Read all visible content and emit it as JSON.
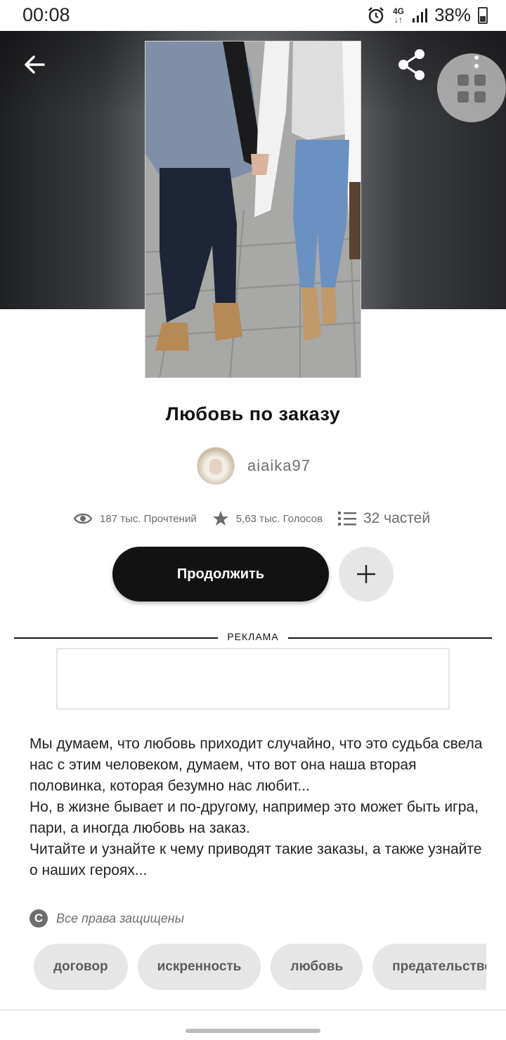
{
  "status_bar": {
    "time": "00:08",
    "network": "4G",
    "battery": "38%"
  },
  "icons": {
    "back": "arrow-left-icon",
    "share": "share-icon",
    "more": "more-vertical-icon",
    "grid": "grid-icon",
    "reads": "eye-icon",
    "votes": "star-icon",
    "parts": "list-icon",
    "add": "plus-icon",
    "copyright": "copyright-icon"
  },
  "story": {
    "title": "Любовь по заказу",
    "author": "aiaika97",
    "reads": "187 тыс. Прочтений",
    "votes": "5,63 тыс. Голосов",
    "parts": "32 частей"
  },
  "actions": {
    "continue_label": "Продолжить"
  },
  "ad": {
    "label": "РЕКЛАМА"
  },
  "description": "Мы думаем, что любовь приходит случайно, что это судьба свела нас с этим человеком, думаем, что вот она наша вторая половинка, которая безумно нас любит...\nНо, в жизне бывает и по-другому, например это может быть игра, пари, а иногда любовь на заказ.\nЧитайте и узнайте к чему приводят такие заказы, а также узнайте о наших героях...",
  "copyright": {
    "symbol": "C",
    "text": "Все права защищены"
  },
  "tags": [
    "договор",
    "искренность",
    "любовь",
    "предательство"
  ],
  "colors": {
    "accent": "#121212",
    "muted_text": "#6b6b6b",
    "tag_background": "#e6e6e6"
  }
}
